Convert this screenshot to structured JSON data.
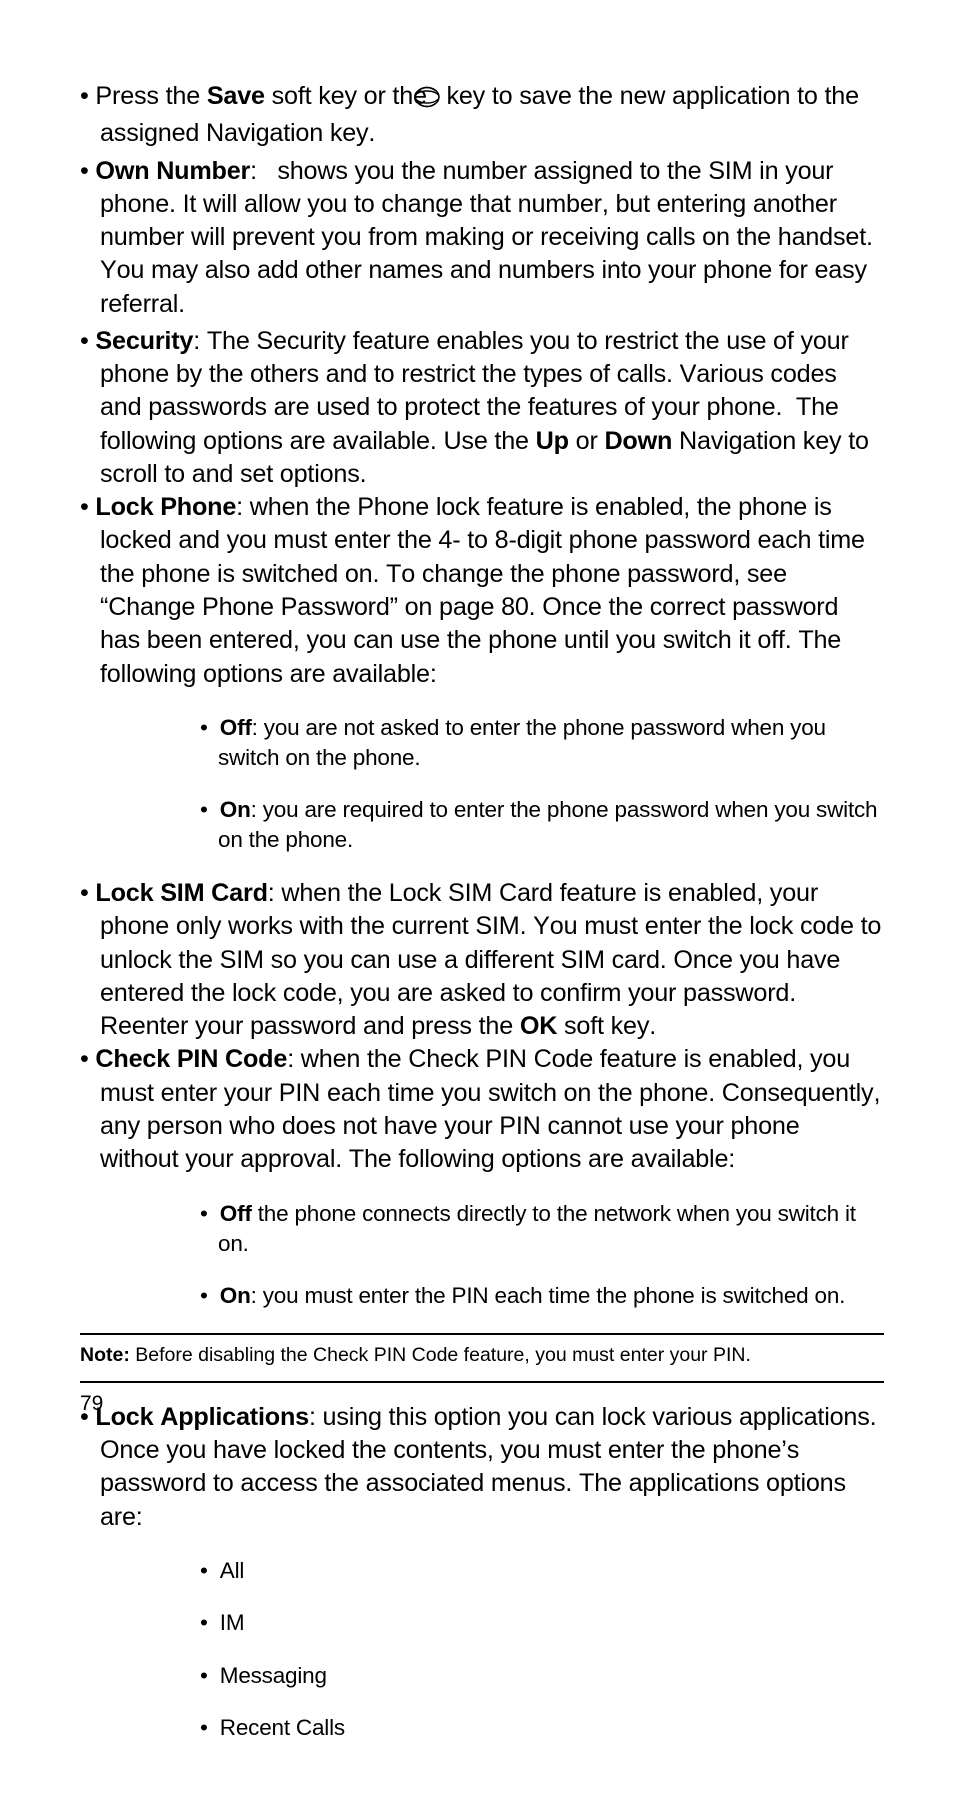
{
  "para": {
    "save_1a": "• Press the ",
    "save_1b": "Save",
    "save_1c": " soft key or the ",
    "save_1d": " key to save the new application to the assigned Navigation key.",
    "own_a": "• ",
    "own_b": "Own Number",
    "own_c": ":   shows you the number assigned to the SIM in your phone. It will allow you to change that number, but entering another number will prevent you from making or receiving calls on the handset. You may also add other names and numbers into your phone for easy referral.",
    "sec_a": "• ",
    "sec_b": "Security",
    "sec_c": ": The Security feature enables you to restrict the use of your phone by the others and to restrict the types of calls. Various codes and passwords are used to protect the features of your phone.  The following options are available. Use the ",
    "sec_d": "Up",
    "sec_e": " or ",
    "sec_f": "Down",
    "sec_g": " Navigation key to scroll to and set options.",
    "lp_a": "• ",
    "lp_b": "Lock Phone",
    "lp_c": ": when the Phone lock feature is enabled, the phone is locked and you must enter the 4- to 8-digit phone password each time the phone is switched on. To change the phone password, see “Change Phone Password” on page 80. Once the correct password has been entered, you can use the phone until you switch it off. The following options are available:",
    "lp_off_a": "Off",
    "lp_off_b": ": you are not asked to enter the phone password when you switch on the phone.",
    "lp_on_a": "On",
    "lp_on_b": ": you are required to enter the phone password when you switch on the phone.",
    "lsim_a": "• ",
    "lsim_b": "Lock SIM Card",
    "lsim_c": ": when the Lock SIM Card feature is enabled, your phone only works with the current SIM. You must enter the lock code to unlock the SIM so you can use a different SIM card. Once you have entered the lock code, you are asked to confirm your password. Reenter your password and press the ",
    "lsim_d": "OK",
    "lsim_e": " soft key.",
    "cpc_a": "• ",
    "cpc_b": "Check PIN Code",
    "cpc_c": ": when the Check PIN Code feature is enabled, you must enter your PIN each time you switch on the phone. Consequently, any person who does not have your PIN cannot use your phone without your approval. The following options are available:",
    "cpc_off_a": "Off",
    "cpc_off_b": " the phone connects directly to the network when you switch it on.",
    "cpc_on_a": "On",
    "cpc_on_b": ": you must enter the PIN each time the phone is switched on.",
    "note_a": "Note:",
    "note_b": " Before disabling the Check PIN Code feature, you must enter your PIN.",
    "lapp_a": "• ",
    "lapp_b": "Lock Applications",
    "lapp_c": ": using this option you can lock various applications. Once you have locked the contents, you must enter the phone’s password to access the associated menus. The applications options are:",
    "li_all": "All",
    "li_im": "IM",
    "li_msg": "Messaging",
    "li_rc": "Recent Calls"
  },
  "page_number": "79"
}
